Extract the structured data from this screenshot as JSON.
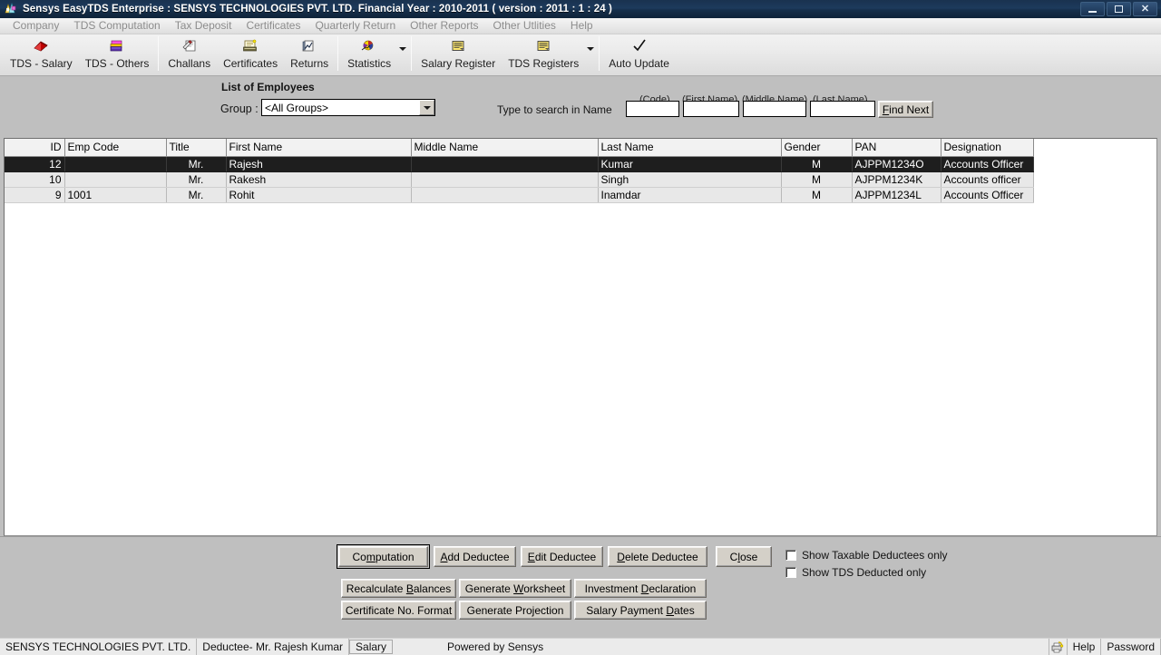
{
  "window": {
    "title": "Sensys EasyTDS Enterprise : SENSYS TECHNOLOGIES PVT. LTD. Financial Year : 2010-2011 ( version : 2011 : 1 : 24 )",
    "app_icon": "sensys-logo-icon",
    "minimize_label": "Minimize",
    "maximize_label": "Maximize",
    "close_label": "Close"
  },
  "menubar": {
    "items": [
      {
        "label": "Company"
      },
      {
        "label": "TDS Computation"
      },
      {
        "label": "Tax Deposit"
      },
      {
        "label": "Certificates"
      },
      {
        "label": "Quarterly Return"
      },
      {
        "label": "Other Reports"
      },
      {
        "label": "Other Utlities"
      },
      {
        "label": "Help"
      }
    ]
  },
  "toolbar": {
    "items": [
      {
        "label": "TDS - Salary",
        "icon": "red-book-icon"
      },
      {
        "label": "TDS - Others",
        "icon": "purple-books-icon"
      },
      {
        "label": "Challans",
        "icon": "challan-icon"
      },
      {
        "label": "Certificates",
        "icon": "certificate-icon"
      },
      {
        "label": "Returns",
        "icon": "returns-icon"
      },
      {
        "label": "Statistics",
        "icon": "statistics-icon"
      },
      {
        "label": "Salary Register",
        "icon": "register-icon"
      },
      {
        "label": "TDS Registers",
        "icon": "register-icon"
      },
      {
        "label": "Auto Update",
        "icon": "checkmark-icon"
      }
    ]
  },
  "form": {
    "heading": "List of Employees",
    "group_label": "Group :",
    "group_value": "<All Groups>",
    "group_options": [
      "<All Groups>"
    ],
    "search_label": "Type to search in Name",
    "search_fields": [
      {
        "hint_prefix": "(",
        "hint": "Code",
        "hint_suffix": ")",
        "accel": "",
        "value": "",
        "placeholder": ""
      },
      {
        "hint_prefix": "(First ",
        "hint": "N",
        "hint_suffix": "ame)",
        "accel": "N",
        "value": "",
        "placeholder": ""
      },
      {
        "hint_prefix": "(",
        "hint": "Middle Name",
        "hint_suffix": ")",
        "accel": "",
        "value": "",
        "placeholder": ""
      },
      {
        "hint_prefix": "(",
        "hint": "Last Name",
        "hint_suffix": ")",
        "accel": "",
        "value": "",
        "placeholder": ""
      }
    ],
    "find_next_label": "Find Next"
  },
  "grid": {
    "columns": [
      "ID",
      "Emp Code",
      "Title",
      "First Name",
      "Middle Name",
      "Last Name",
      "Gender",
      "PAN",
      "Designation"
    ],
    "rows": [
      {
        "id": "12",
        "emp_code": "",
        "title": "Mr.",
        "first_name": "Rajesh",
        "middle_name": "",
        "last_name": "Kumar",
        "gender": "M",
        "pan": "AJPPM1234O",
        "designation": "Accounts Officer",
        "selected": true
      },
      {
        "id": "10",
        "emp_code": "",
        "title": "Mr.",
        "first_name": "Rakesh",
        "middle_name": "",
        "last_name": "Singh",
        "gender": "M",
        "pan": "AJPPM1234K",
        "designation": "Accounts officer",
        "selected": false
      },
      {
        "id": "9",
        "emp_code": "1001",
        "title": "Mr.",
        "first_name": "Rohit",
        "middle_name": "",
        "last_name": "Inamdar",
        "gender": "M",
        "pan": "AJPPM1234L",
        "designation": "Accounts Officer",
        "selected": false
      }
    ]
  },
  "actions": {
    "row1": [
      {
        "label": "Computation",
        "accel": "m",
        "focused": true
      },
      {
        "label": "Add Deductee",
        "accel": "A",
        "focused": false
      },
      {
        "label": "Edit Deductee",
        "accel": "E",
        "focused": false
      },
      {
        "label": "Delete Deductee",
        "accel": "D",
        "focused": false
      },
      {
        "label": "Close",
        "accel": "l",
        "focused": false
      }
    ],
    "row2": [
      {
        "label": "Recalculate Balances",
        "accel": "B"
      },
      {
        "label": "Generate Worksheet",
        "accel": "W"
      },
      {
        "label": "Investment Declaration",
        "accel": "D"
      }
    ],
    "row3": [
      {
        "label": "Certificate No. Format",
        "accel": ""
      },
      {
        "label": "Generate Projection",
        "accel": "j"
      },
      {
        "label": "Salary Payment Dates",
        "accel": "D"
      }
    ],
    "checkboxes": [
      {
        "label": "Show Taxable Deductees only",
        "checked": false
      },
      {
        "label": "Show TDS Deducted only",
        "checked": false
      }
    ]
  },
  "statusbar": {
    "company": "SENSYS TECHNOLOGIES PVT. LTD.",
    "deductee": "Deductee- Mr. Rajesh  Kumar",
    "mode": "Salary",
    "powered_by": "Powered by Sensys",
    "printer_icon": "printer-icon",
    "help": "Help",
    "password": "Password"
  },
  "colors": {
    "titlebar_dark": "#16304c",
    "selection": "#1e1e1e",
    "face": "#bfbfbf",
    "button_face": "#d4d0c8"
  }
}
